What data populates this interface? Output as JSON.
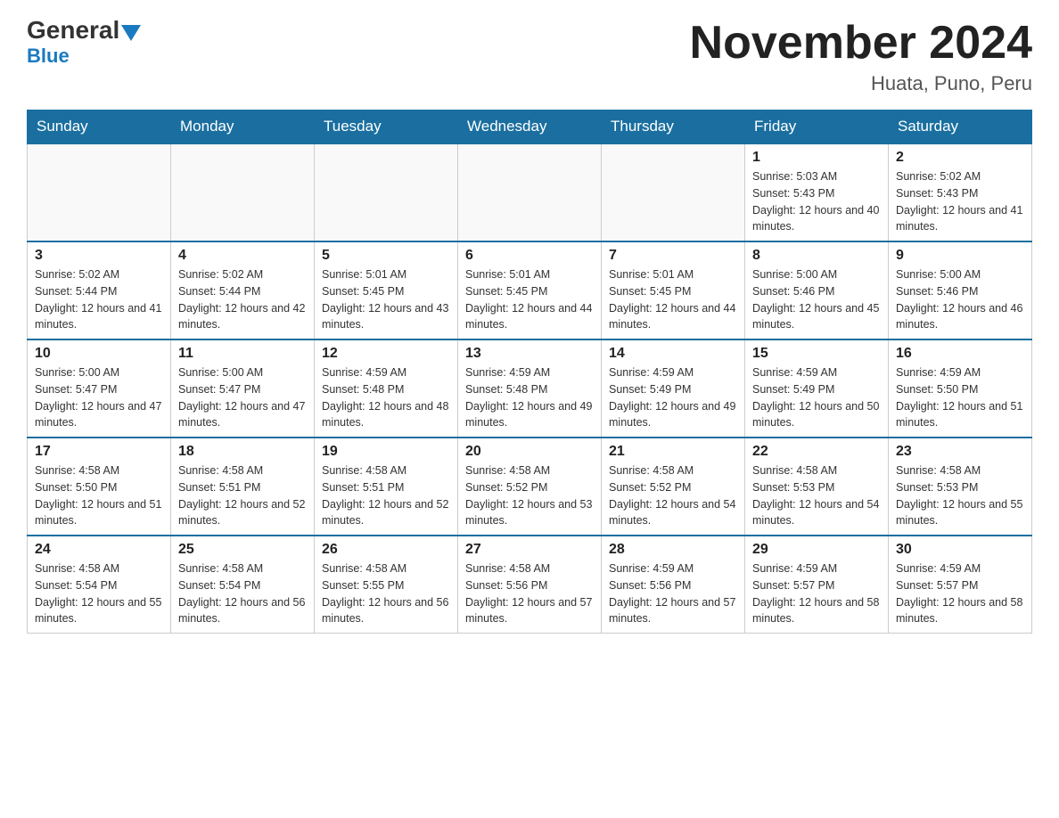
{
  "logo": {
    "part1": "General",
    "part2": "Blue"
  },
  "title": "November 2024",
  "subtitle": "Huata, Puno, Peru",
  "days_of_week": [
    "Sunday",
    "Monday",
    "Tuesday",
    "Wednesday",
    "Thursday",
    "Friday",
    "Saturday"
  ],
  "weeks": [
    [
      {
        "day": "",
        "info": ""
      },
      {
        "day": "",
        "info": ""
      },
      {
        "day": "",
        "info": ""
      },
      {
        "day": "",
        "info": ""
      },
      {
        "day": "",
        "info": ""
      },
      {
        "day": "1",
        "info": "Sunrise: 5:03 AM\nSunset: 5:43 PM\nDaylight: 12 hours and 40 minutes."
      },
      {
        "day": "2",
        "info": "Sunrise: 5:02 AM\nSunset: 5:43 PM\nDaylight: 12 hours and 41 minutes."
      }
    ],
    [
      {
        "day": "3",
        "info": "Sunrise: 5:02 AM\nSunset: 5:44 PM\nDaylight: 12 hours and 41 minutes."
      },
      {
        "day": "4",
        "info": "Sunrise: 5:02 AM\nSunset: 5:44 PM\nDaylight: 12 hours and 42 minutes."
      },
      {
        "day": "5",
        "info": "Sunrise: 5:01 AM\nSunset: 5:45 PM\nDaylight: 12 hours and 43 minutes."
      },
      {
        "day": "6",
        "info": "Sunrise: 5:01 AM\nSunset: 5:45 PM\nDaylight: 12 hours and 44 minutes."
      },
      {
        "day": "7",
        "info": "Sunrise: 5:01 AM\nSunset: 5:45 PM\nDaylight: 12 hours and 44 minutes."
      },
      {
        "day": "8",
        "info": "Sunrise: 5:00 AM\nSunset: 5:46 PM\nDaylight: 12 hours and 45 minutes."
      },
      {
        "day": "9",
        "info": "Sunrise: 5:00 AM\nSunset: 5:46 PM\nDaylight: 12 hours and 46 minutes."
      }
    ],
    [
      {
        "day": "10",
        "info": "Sunrise: 5:00 AM\nSunset: 5:47 PM\nDaylight: 12 hours and 47 minutes."
      },
      {
        "day": "11",
        "info": "Sunrise: 5:00 AM\nSunset: 5:47 PM\nDaylight: 12 hours and 47 minutes."
      },
      {
        "day": "12",
        "info": "Sunrise: 4:59 AM\nSunset: 5:48 PM\nDaylight: 12 hours and 48 minutes."
      },
      {
        "day": "13",
        "info": "Sunrise: 4:59 AM\nSunset: 5:48 PM\nDaylight: 12 hours and 49 minutes."
      },
      {
        "day": "14",
        "info": "Sunrise: 4:59 AM\nSunset: 5:49 PM\nDaylight: 12 hours and 49 minutes."
      },
      {
        "day": "15",
        "info": "Sunrise: 4:59 AM\nSunset: 5:49 PM\nDaylight: 12 hours and 50 minutes."
      },
      {
        "day": "16",
        "info": "Sunrise: 4:59 AM\nSunset: 5:50 PM\nDaylight: 12 hours and 51 minutes."
      }
    ],
    [
      {
        "day": "17",
        "info": "Sunrise: 4:58 AM\nSunset: 5:50 PM\nDaylight: 12 hours and 51 minutes."
      },
      {
        "day": "18",
        "info": "Sunrise: 4:58 AM\nSunset: 5:51 PM\nDaylight: 12 hours and 52 minutes."
      },
      {
        "day": "19",
        "info": "Sunrise: 4:58 AM\nSunset: 5:51 PM\nDaylight: 12 hours and 52 minutes."
      },
      {
        "day": "20",
        "info": "Sunrise: 4:58 AM\nSunset: 5:52 PM\nDaylight: 12 hours and 53 minutes."
      },
      {
        "day": "21",
        "info": "Sunrise: 4:58 AM\nSunset: 5:52 PM\nDaylight: 12 hours and 54 minutes."
      },
      {
        "day": "22",
        "info": "Sunrise: 4:58 AM\nSunset: 5:53 PM\nDaylight: 12 hours and 54 minutes."
      },
      {
        "day": "23",
        "info": "Sunrise: 4:58 AM\nSunset: 5:53 PM\nDaylight: 12 hours and 55 minutes."
      }
    ],
    [
      {
        "day": "24",
        "info": "Sunrise: 4:58 AM\nSunset: 5:54 PM\nDaylight: 12 hours and 55 minutes."
      },
      {
        "day": "25",
        "info": "Sunrise: 4:58 AM\nSunset: 5:54 PM\nDaylight: 12 hours and 56 minutes."
      },
      {
        "day": "26",
        "info": "Sunrise: 4:58 AM\nSunset: 5:55 PM\nDaylight: 12 hours and 56 minutes."
      },
      {
        "day": "27",
        "info": "Sunrise: 4:58 AM\nSunset: 5:56 PM\nDaylight: 12 hours and 57 minutes."
      },
      {
        "day": "28",
        "info": "Sunrise: 4:59 AM\nSunset: 5:56 PM\nDaylight: 12 hours and 57 minutes."
      },
      {
        "day": "29",
        "info": "Sunrise: 4:59 AM\nSunset: 5:57 PM\nDaylight: 12 hours and 58 minutes."
      },
      {
        "day": "30",
        "info": "Sunrise: 4:59 AM\nSunset: 5:57 PM\nDaylight: 12 hours and 58 minutes."
      }
    ]
  ]
}
